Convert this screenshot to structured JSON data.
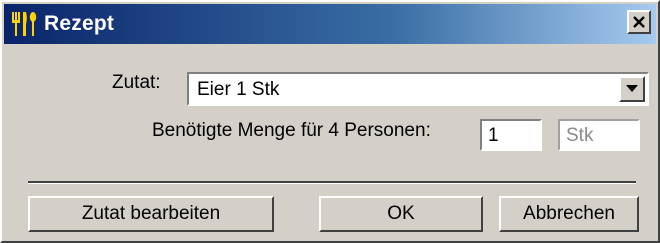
{
  "window": {
    "title": "Rezept",
    "icon": "cutlery-icon",
    "close_icon": "close-icon"
  },
  "form": {
    "ingredient_label": "Zutat:",
    "ingredient_value": "Eier 1 Stk",
    "quantity_label": "Benötigte Menge für 4 Personen:",
    "quantity_value": "1",
    "unit_value": "Stk"
  },
  "buttons": {
    "edit_label": "Zutat bearbeiten",
    "ok_label": "OK",
    "cancel_label": "Abbrechen"
  },
  "colors": {
    "title_gradient_start": "#0a246a",
    "title_gradient_end": "#a6caf0",
    "face": "#d4d0c8"
  }
}
